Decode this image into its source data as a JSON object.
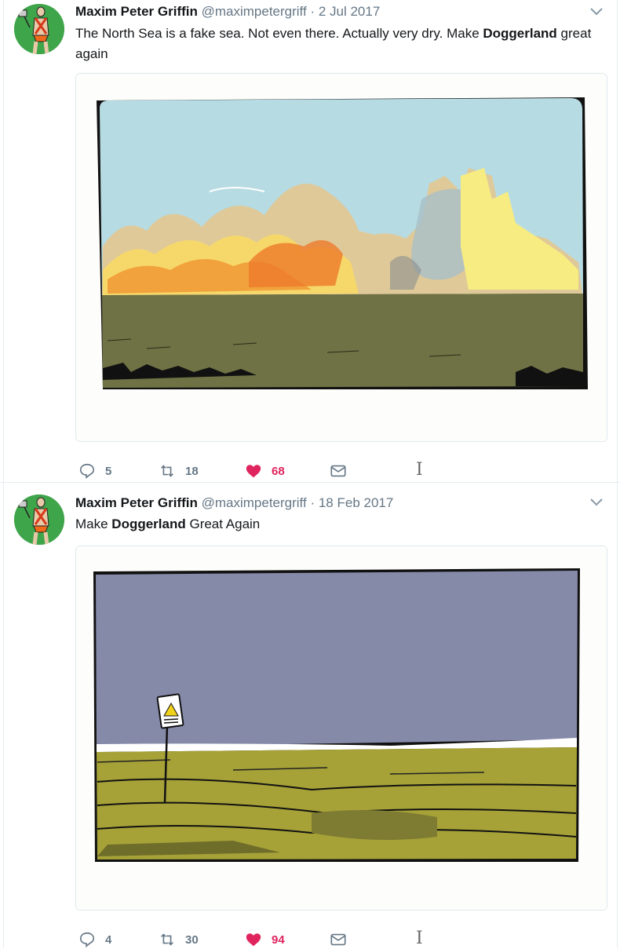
{
  "tweets": [
    {
      "name": "Maxim Peter Griffin",
      "handle": "@maximpetergriff",
      "separator": "·",
      "date": "2 Jul 2017",
      "text_before": "The North Sea is a fake sea. Not even there. Actually very dry. Make ",
      "text_bold": "Doggerland",
      "text_after": " great again",
      "replies": "5",
      "retweets": "18",
      "likes": "68"
    },
    {
      "name": "Maxim Peter Griffin",
      "handle": "@maximpetergriff",
      "separator": "·",
      "date": "18 Feb 2017",
      "text_before": "Make ",
      "text_bold": "Doggerland",
      "text_after": " Great Again",
      "replies": "4",
      "retweets": "30",
      "likes": "94"
    }
  ],
  "icons": {
    "reply": "reply-icon",
    "retweet": "retweet-icon",
    "like": "heart-icon",
    "dm": "envelope-icon",
    "caret": "chevron-down-icon"
  },
  "colors": {
    "like": "#e0245e",
    "muted": "#657786",
    "avatar_bg": "#3fa54a"
  }
}
